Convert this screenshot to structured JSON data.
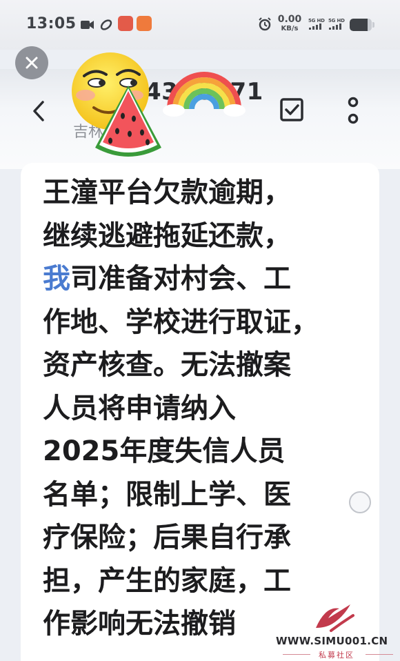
{
  "status_bar": {
    "time": "13:05",
    "net_speed_value": "0.00",
    "net_speed_unit": "KB/s",
    "sim1_label": "5G HD",
    "sim2_label": "5G HD",
    "battery_level_percent": 80,
    "icons": [
      "camera-icon",
      "link-icon",
      "app-notification-icon",
      "app-notification-icon",
      "alarm-icon",
      "signal-icon",
      "battery-icon"
    ]
  },
  "header": {
    "contact_number": "43··8371",
    "contact_subtitle": "吉林",
    "icons": [
      "close-icon",
      "back-arrow-icon",
      "select-check-icon",
      "more-vertical-icon"
    ]
  },
  "message": {
    "first_char": "我",
    "lines": [
      "王潼平台欠款逾期，",
      "继续逃避拖延还款，",
      "我司准备对村会、工",
      "作地、学校进行取证，",
      "资产核查。无法撤案",
      "人员将申请纳入",
      "2025年度失信人员",
      "名单；限制上学、医",
      "疗保险；后果自行承",
      "担，产生的家庭，工",
      "作影响无法撤销"
    ]
  },
  "stickers": [
    "smirk-emoji-sticker",
    "watermelon-sticker",
    "rainbow-sticker"
  ],
  "watermark": {
    "url": "WWW.SIMU001.CN",
    "label": "私募社区",
    "brand_color": "#c23a4c"
  },
  "colors": {
    "text": "#1c1c1e",
    "link_highlight": "#4a7bd0",
    "background": "#eceff4"
  }
}
